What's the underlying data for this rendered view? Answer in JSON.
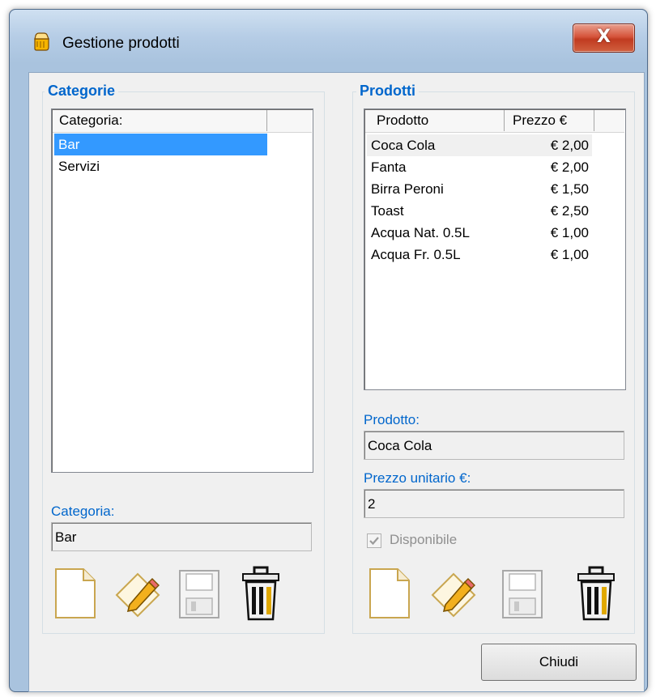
{
  "window": {
    "title": "Gestione prodotti",
    "title_icon": "hand-icon",
    "close_label": "X"
  },
  "categories_panel": {
    "group_title": "Categorie",
    "columns": [
      "Categoria:",
      ""
    ],
    "rows": [
      "Bar",
      "Servizi"
    ],
    "selected_index": 0,
    "field_label": "Categoria:",
    "field_value": "Bar",
    "toolbar": [
      "new-document-icon",
      "edit-pencil-icon",
      "save-floppy-icon",
      "delete-trash-icon"
    ]
  },
  "products_panel": {
    "group_title": "Prodotti",
    "columns": [
      "Prodotto",
      "Prezzo €",
      ""
    ],
    "rows": [
      {
        "name": "Coca Cola",
        "price": "€ 2,00"
      },
      {
        "name": "Fanta",
        "price": "€ 2,00"
      },
      {
        "name": "Birra Peroni",
        "price": "€ 1,50"
      },
      {
        "name": "Toast",
        "price": "€ 2,50"
      },
      {
        "name": "Acqua Nat. 0.5L",
        "price": "€ 1,00"
      },
      {
        "name": "Acqua Fr. 0.5L",
        "price": "€ 1,00"
      }
    ],
    "selected_index": 0,
    "product_label": "Prodotto:",
    "product_value": "Coca Cola",
    "price_label": "Prezzo unitario €:",
    "price_value": "2",
    "available_label": "Disponibile",
    "available_checked": true,
    "toolbar": [
      "new-document-icon",
      "edit-pencil-icon",
      "save-floppy-icon",
      "delete-trash-icon"
    ]
  },
  "footer": {
    "close_button_label": "Chiudi"
  },
  "colors": {
    "accent_blue": "#0066cc",
    "selection_blue": "#3399ff",
    "window_frame": "#a9c3de",
    "close_red": "#c13b21"
  }
}
